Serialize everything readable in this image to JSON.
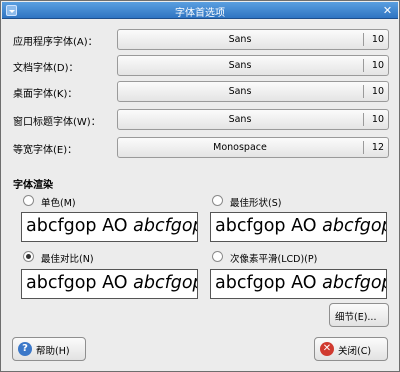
{
  "window": {
    "title": "字体首选项"
  },
  "fonts": [
    {
      "label": "应用程序字体(A)：",
      "name": "Sans",
      "size": "10"
    },
    {
      "label": "文档字体(D)：",
      "name": "Sans",
      "size": "10"
    },
    {
      "label": "桌面字体(K)：",
      "name": "Sans",
      "size": "10"
    },
    {
      "label": "窗口标题字体(W)：",
      "name": "Sans",
      "size": "10"
    },
    {
      "label": "等宽字体(E)：",
      "name": "Monospace",
      "size": "12"
    }
  ],
  "rendering": {
    "title": "字体渲染",
    "sample_text": "abcfgop AO ",
    "sample_italic": "abcfgop",
    "options": [
      {
        "label": "单色(M)",
        "checked": false
      },
      {
        "label": "最佳形状(S)",
        "checked": false
      },
      {
        "label": "最佳对比(N)",
        "checked": true
      },
      {
        "label": "次像素平滑(LCD)(P)",
        "checked": false
      }
    ]
  },
  "buttons": {
    "details": "细节(E)...",
    "help": "帮助(H)",
    "close": "关闭(C)"
  },
  "colors": {
    "titlebar": "#2f74c2",
    "window_bg": "#ececec"
  }
}
